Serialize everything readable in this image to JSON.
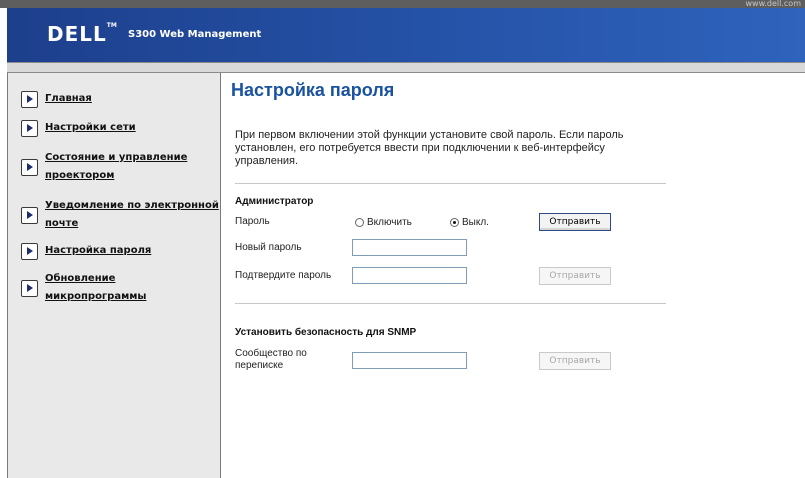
{
  "header": {
    "site_url": "www.dell.com",
    "logo": "DELL",
    "logo_tm": "TM",
    "product": "S300 Web Management"
  },
  "sidebar": {
    "items": [
      {
        "label": "Главная",
        "icon": "arrow-right-icon"
      },
      {
        "label": "Настройки сети",
        "icon": "arrow-right-icon"
      },
      {
        "label_line1": "Состояние и управление",
        "label_line2": "проектором",
        "icon": "arrow-right-icon"
      },
      {
        "label_line1": "Уведомление по электронной",
        "label_line2": "почте",
        "icon": "arrow-right-icon"
      },
      {
        "label": "Настройка пароля",
        "icon": "arrow-right-icon"
      },
      {
        "label": "Обновление микропрограммы",
        "icon": "arrow-right-icon"
      }
    ]
  },
  "main": {
    "title": "Настройка пароля",
    "intro": "При первом включении этой функции установите свой пароль. Если пароль установлен, его потребуется ввести при подключении к веб-интерфейсу управления.",
    "admin": {
      "section": "Администратор",
      "password_label": "Пароль",
      "enable_label": "Включить",
      "off_label": "Выкл.",
      "selected": "off",
      "submit_label": "Отправить",
      "new_password_label": "Новый пароль",
      "new_password_value": "",
      "confirm_label": "Подтвердите пароль",
      "confirm_value": "",
      "confirm_submit_label": "Отправить"
    },
    "snmp": {
      "section": "Установить безопасность для SNMP",
      "community_label_line1": "Сообщество по",
      "community_label_line2": "переписке",
      "community_value": "",
      "submit_label": "Отправить"
    }
  },
  "colors": {
    "banner": "#2553a8",
    "title": "#1a53a0",
    "sidebar_bg": "#e9e9e9"
  }
}
